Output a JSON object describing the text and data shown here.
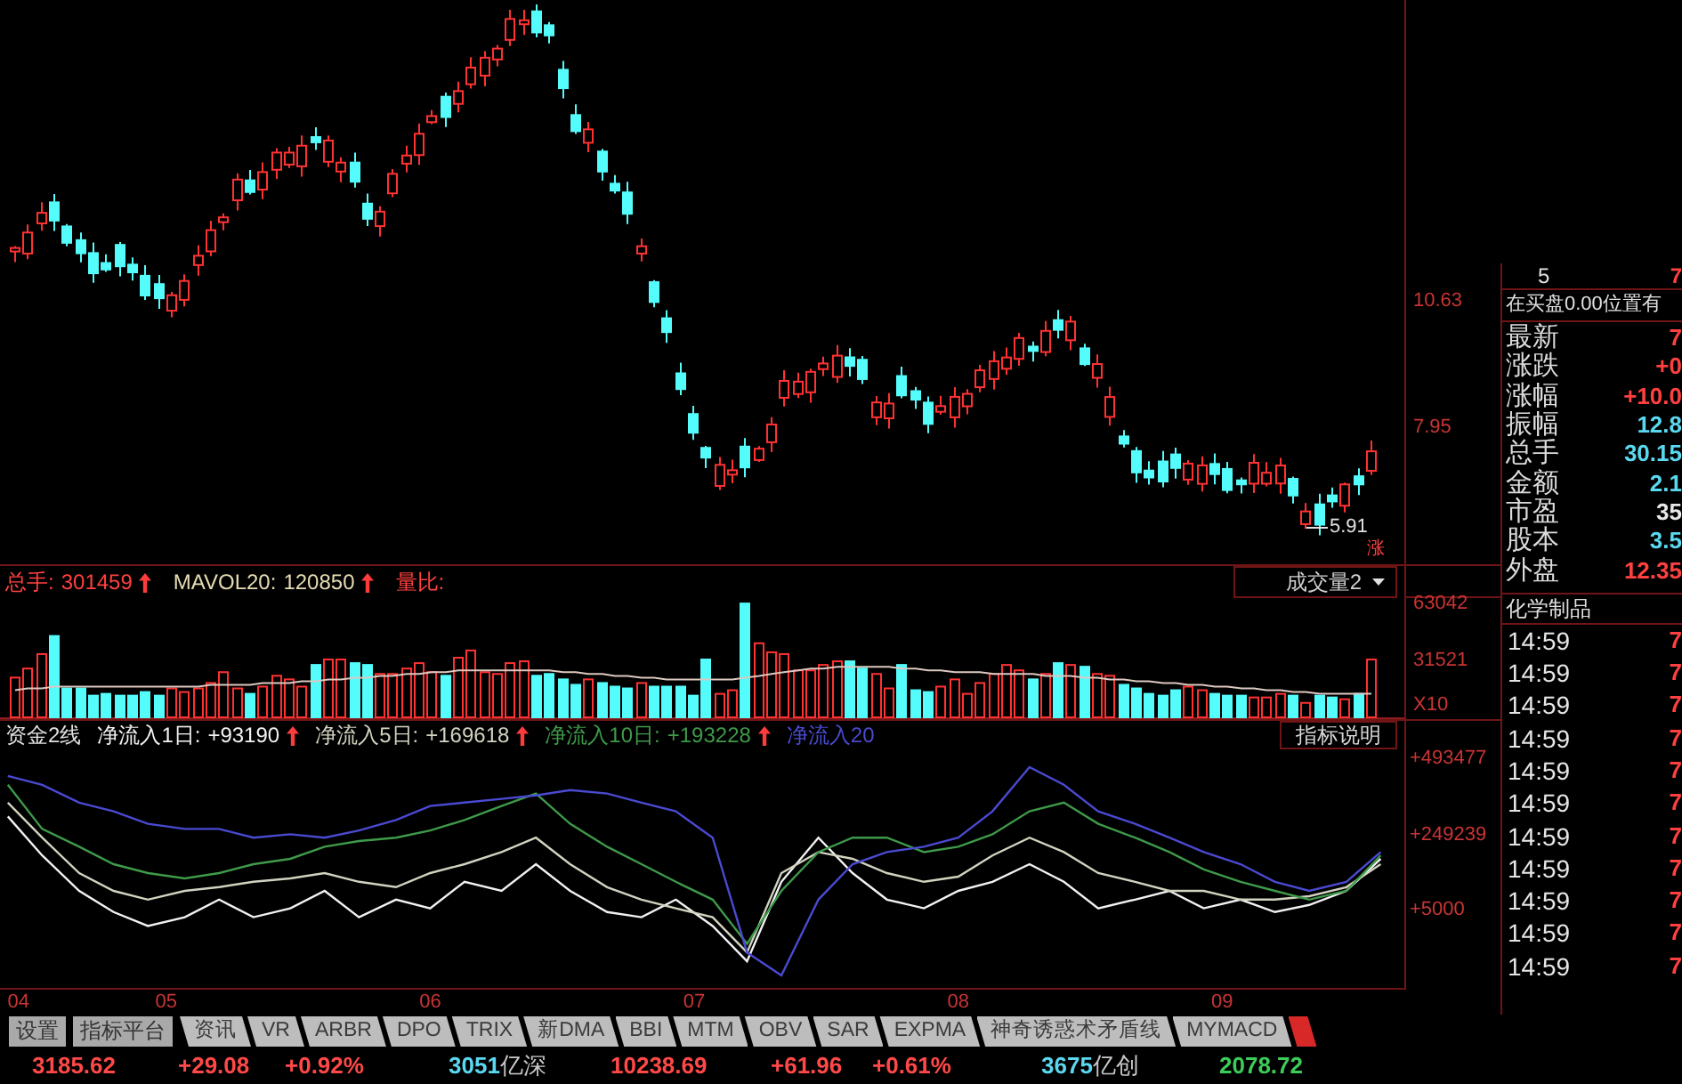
{
  "price_chart": {
    "axis_labels": [
      "10.63",
      "7.95"
    ],
    "low_marker": "5.91",
    "corner_label": "涨"
  },
  "volume_panel": {
    "legend": [
      {
        "label": "总手:",
        "value": "301459",
        "arrow_up": true,
        "color": "#ff4040"
      },
      {
        "label": "MAVOL20:",
        "value": "120850",
        "arrow_up": true,
        "color": "#e6dcb4"
      },
      {
        "label": "量比:",
        "color": "#ff4040"
      }
    ],
    "dropdown": "成交量2",
    "series_hollow": [
      true,
      false
    ],
    "chart_data": {
      "type": "bar",
      "ylabel": "X10",
      "ylim": [
        0,
        66000
      ],
      "yticks": [
        {
          "value": 63042,
          "label": "63042"
        },
        {
          "value": 31521,
          "label": "31521"
        }
      ],
      "series": [
        {
          "color": "#ff3232",
          "values": [
            22000,
            27000,
            35000,
            null,
            null,
            null,
            null,
            null,
            null,
            null,
            null,
            null,
            16000,
            14000,
            16000,
            19000,
            25000,
            16000,
            null,
            17000,
            23000,
            21000,
            17000,
            null,
            32000,
            32000,
            null,
            null,
            24000,
            24000,
            27000,
            30000,
            25000,
            null,
            33000,
            37000,
            25000,
            24000,
            30000,
            31000,
            null,
            null,
            null,
            null,
            21000,
            null,
            null,
            null,
            19000,
            null,
            null,
            null,
            null,
            null,
            13000,
            15000,
            null,
            41000,
            36000,
            35000,
            26000,
            26000,
            29000,
            31000,
            null,
            null,
            24000,
            16000,
            null,
            null,
            null,
            17000,
            21000,
            13000,
            19000,
            24000,
            29000,
            26000,
            null,
            24000,
            null,
            29000,
            null,
            24000,
            23000,
            null,
            null,
            null,
            null,
            null,
            17000,
            15000,
            null,
            null,
            null,
            11000,
            11000,
            13000,
            null,
            8000,
            null,
            null,
            10000,
            null,
            32000
          ]
        },
        {
          "color": "#54fcfc",
          "values": [
            null,
            null,
            null,
            45000,
            16000,
            16000,
            12000,
            13000,
            12000,
            12000,
            14000,
            12000,
            null,
            null,
            null,
            null,
            null,
            null,
            13000,
            null,
            null,
            null,
            null,
            29000,
            null,
            null,
            30000,
            29000,
            null,
            null,
            null,
            null,
            null,
            23000,
            null,
            null,
            null,
            null,
            null,
            null,
            23000,
            24000,
            21000,
            18000,
            null,
            19000,
            17000,
            16000,
            null,
            17000,
            17000,
            17000,
            12000,
            32000,
            null,
            null,
            63000,
            null,
            null,
            null,
            null,
            null,
            null,
            null,
            31000,
            27000,
            null,
            null,
            29000,
            15000,
            14000,
            null,
            null,
            null,
            null,
            null,
            null,
            null,
            21000,
            null,
            30000,
            null,
            28000,
            null,
            null,
            18000,
            16000,
            13000,
            12000,
            15000,
            null,
            null,
            13000,
            12000,
            12000,
            null,
            null,
            null,
            12000,
            null,
            12000,
            11000,
            null,
            13000,
            null
          ]
        },
        {
          "type": "line",
          "color": "#dcc8c0",
          "values": [
            15000,
            16000,
            16000,
            17000,
            17000,
            17000,
            17000,
            17000,
            17000,
            17000,
            17000,
            17000,
            17000,
            17000,
            17000,
            18000,
            18000,
            18000,
            18000,
            19000,
            19000,
            19000,
            20000,
            20000,
            21000,
            21000,
            22000,
            22000,
            23000,
            23000,
            24000,
            24000,
            25000,
            25000,
            26000,
            26000,
            26000,
            26000,
            26000,
            26000,
            26000,
            26000,
            25000,
            25000,
            24000,
            24000,
            23000,
            23000,
            22000,
            22000,
            21000,
            21000,
            21000,
            21000,
            21000,
            21000,
            22000,
            23000,
            24000,
            25000,
            26000,
            27000,
            27000,
            28000,
            28000,
            28000,
            28000,
            28000,
            27000,
            27000,
            26000,
            26000,
            25000,
            25000,
            25000,
            24000,
            24000,
            24000,
            24000,
            23000,
            23000,
            23000,
            22000,
            22000,
            21000,
            21000,
            20000,
            20000,
            19000,
            19000,
            18000,
            18000,
            17000,
            17000,
            16000,
            16000,
            15000,
            15000,
            14000,
            14000,
            13000,
            13000,
            13000,
            13000,
            13000
          ]
        }
      ]
    }
  },
  "flow_panel": {
    "legend": [
      {
        "label": "净流入1日:",
        "value": "+93190",
        "arrow_up": true
      },
      {
        "label": "净流入5日:",
        "value": "+169618",
        "arrow_up": true
      },
      {
        "label": "净流入10日:",
        "value": "+193228",
        "arrow_up": true
      },
      {
        "label": "净流入20"
      }
    ],
    "help_button": "指标说明",
    "chart_data": {
      "type": "line",
      "title": "资金2线",
      "x": [
        4.4,
        4.53,
        4.67,
        4.8,
        4.93,
        5.07,
        5.2,
        5.33,
        5.47,
        5.6,
        5.73,
        5.87,
        6.0,
        6.13,
        6.27,
        6.4,
        6.53,
        6.67,
        6.8,
        6.93,
        7.07,
        7.2,
        7.33,
        7.47,
        7.6,
        7.73,
        7.87,
        8.0,
        8.13,
        8.27,
        8.4,
        8.53,
        8.67,
        8.8,
        8.93,
        9.07,
        9.2,
        9.33,
        9.47,
        9.6
      ],
      "xlim": [
        4.37,
        9.69
      ],
      "ylim": [
        -245000,
        522000
      ],
      "xticks": [
        {
          "value": 4.44,
          "label": "04"
        },
        {
          "value": 5,
          "label": "05"
        },
        {
          "value": 6,
          "label": "06"
        },
        {
          "value": 7,
          "label": "07"
        },
        {
          "value": 8,
          "label": "08"
        },
        {
          "value": 9,
          "label": "09"
        }
      ],
      "yticks": [
        {
          "value": 493477,
          "label": "+493477"
        },
        {
          "value": 249239,
          "label": "+249239"
        },
        {
          "value": 5000,
          "label": "+5000"
        }
      ],
      "series": [
        {
          "color": "#f2f2f2",
          "values": [
            306000,
            181000,
            67000,
            -1000,
            -46000,
            -18000,
            39000,
            -18000,
            11000,
            67000,
            -18000,
            39000,
            11000,
            96000,
            67000,
            153000,
            67000,
            -1000,
            -18000,
            39000,
            -46000,
            -160000,
            96000,
            238000,
            124000,
            39000,
            11000,
            67000,
            96000,
            153000,
            96000,
            11000,
            39000,
            67000,
            11000,
            39000,
            -1000,
            22000,
            67000,
            170000
          ]
        },
        {
          "color": "#d2d2c0",
          "values": [
            351000,
            238000,
            124000,
            67000,
            39000,
            67000,
            79000,
            96000,
            107000,
            124000,
            96000,
            79000,
            124000,
            153000,
            192000,
            238000,
            153000,
            79000,
            39000,
            11000,
            -18000,
            -131000,
            124000,
            192000,
            170000,
            124000,
            96000,
            113000,
            181000,
            238000,
            192000,
            124000,
            96000,
            67000,
            67000,
            39000,
            39000,
            50000,
            79000,
            153000
          ]
        },
        {
          "color": "#3e9a4a",
          "values": [
            408000,
            266000,
            209000,
            153000,
            124000,
            107000,
            124000,
            153000,
            170000,
            209000,
            227000,
            238000,
            261000,
            295000,
            340000,
            380000,
            283000,
            209000,
            153000,
            96000,
            39000,
            -103000,
            67000,
            192000,
            238000,
            238000,
            192000,
            209000,
            249000,
            323000,
            351000,
            283000,
            238000,
            192000,
            136000,
            96000,
            67000,
            39000,
            67000,
            181000
          ]
        },
        {
          "color": "#4a4ad2",
          "values": [
            437000,
            408000,
            351000,
            323000,
            283000,
            266000,
            266000,
            238000,
            249000,
            238000,
            261000,
            295000,
            340000,
            351000,
            363000,
            374000,
            391000,
            380000,
            351000,
            323000,
            238000,
            -131000,
            -205000,
            39000,
            153000,
            192000,
            209000,
            238000,
            323000,
            465000,
            408000,
            323000,
            283000,
            238000,
            192000,
            153000,
            96000,
            67000,
            96000,
            192000
          ]
        }
      ]
    }
  },
  "quote_panel": {
    "header": {
      "column_1": "5",
      "column_2": "7"
    },
    "order_note": "在买盘0.00位置有",
    "rows": [
      {
        "label": "最新",
        "value": "7",
        "color": "#ff4040"
      },
      {
        "label": "涨跌",
        "value": "+0",
        "color": "#ff4040"
      },
      {
        "label": "涨幅",
        "value": "+10.0",
        "color": "#ff4040"
      },
      {
        "label": "振幅",
        "value": "12.8",
        "color": "#5ad8f0"
      },
      {
        "label": "总手",
        "value": "30.15",
        "color": "#5ad8f0"
      },
      {
        "label": "金额",
        "value": "2.1",
        "color": "#5ad8f0"
      },
      {
        "label": "市盈",
        "value": "35",
        "color": "#e8e8e8"
      },
      {
        "label": "股本",
        "value": "3.5",
        "color": "#5ad8f0"
      },
      {
        "label": "外盘",
        "value": "12.35",
        "color": "#ff4040"
      }
    ],
    "sector": "化学制品",
    "ticks": [
      {
        "time": "14:59",
        "price": "7"
      },
      {
        "time": "14:59",
        "price": "7"
      },
      {
        "time": "14:59",
        "price": "7"
      },
      {
        "time": "14:59",
        "price": "7"
      },
      {
        "time": "14:59",
        "price": "7"
      },
      {
        "time": "14:59",
        "price": "7"
      },
      {
        "time": "14:59",
        "price": "7"
      },
      {
        "time": "14:59",
        "price": "7"
      },
      {
        "time": "14:59",
        "price": "7"
      },
      {
        "time": "14:59",
        "price": "7"
      },
      {
        "time": "14:59",
        "price": "7"
      }
    ]
  },
  "tab_bar": [
    {
      "kind": "button",
      "label": "设置"
    },
    {
      "kind": "button",
      "label": "指标平台"
    },
    {
      "kind": "tab",
      "label": "资讯",
      "selected": false
    },
    {
      "kind": "tab",
      "label": "VR",
      "selected": false
    },
    {
      "kind": "tab",
      "label": "ARBR",
      "selected": false
    },
    {
      "kind": "tab",
      "label": "DPO",
      "selected": false
    },
    {
      "kind": "tab",
      "label": "TRIX",
      "selected": false
    },
    {
      "kind": "tab",
      "label": "新DMA",
      "selected": false
    },
    {
      "kind": "tab",
      "label": "BBI",
      "selected": false
    },
    {
      "kind": "tab",
      "label": "MTM",
      "selected": false
    },
    {
      "kind": "tab",
      "label": "OBV",
      "selected": false
    },
    {
      "kind": "tab",
      "label": "SAR",
      "selected": false
    },
    {
      "kind": "tab",
      "label": "EXPMA",
      "selected": false
    },
    {
      "kind": "tab",
      "label": "神奇诱惑术矛盾线",
      "selected": false
    },
    {
      "kind": "tab",
      "label": "MYMACD",
      "selected": false
    },
    {
      "kind": "tab",
      "selected": true
    }
  ],
  "status_bar": [
    {
      "kind": "quote",
      "text": "3185.62",
      "color": "#ff4848"
    },
    {
      "kind": "quote",
      "text": "+29.08",
      "color": "#ff4848"
    },
    {
      "kind": "quote",
      "text": "+0.92%",
      "color": "#ff4848"
    },
    {
      "kind": "turnover",
      "value": "3051",
      "unit": "亿深",
      "color": "#5ad8f0"
    },
    {
      "kind": "quote",
      "text": "10238.69",
      "color": "#ff4848"
    },
    {
      "kind": "quote",
      "text": "+61.96",
      "color": "#ff4848"
    },
    {
      "kind": "quote",
      "text": "+0.61%",
      "color": "#ff4848"
    },
    {
      "kind": "turnover",
      "value": "3675",
      "unit": "亿创",
      "color": "#5ad8f0"
    },
    {
      "kind": "quote",
      "text": "2078.72",
      "color": "#3ccc5a"
    }
  ]
}
